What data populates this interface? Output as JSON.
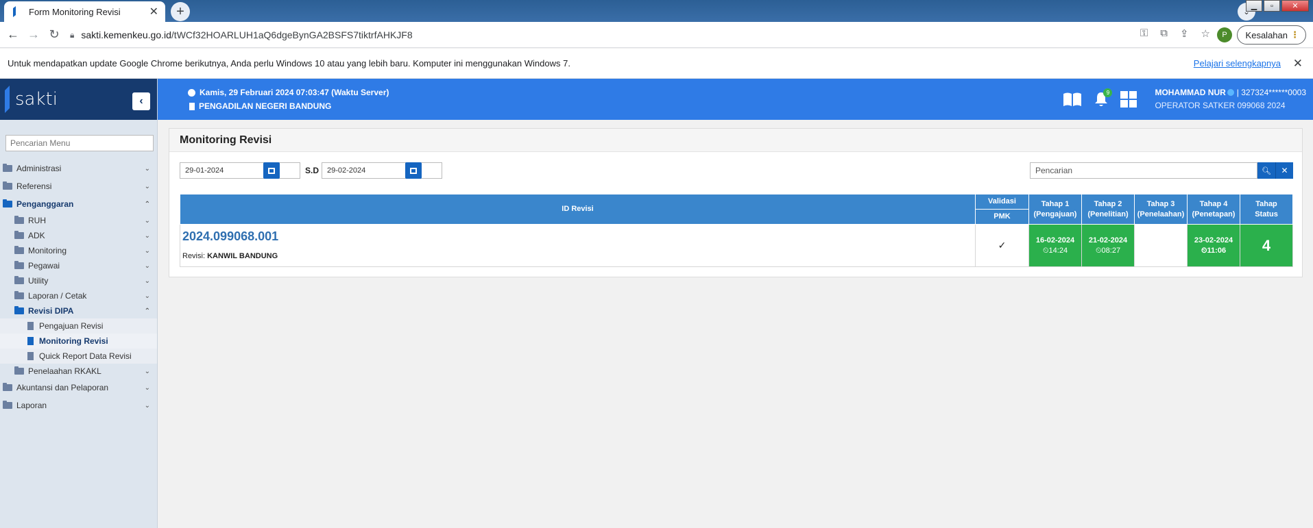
{
  "browser": {
    "tab_title": "Form Monitoring Revisi",
    "url_domain": "sakti.kemenkeu.go.id",
    "url_path": "/tWCf32HOARLUH1aQ6dgeBynGA2BSFS7tiktrfAHKJF8",
    "profile_initial": "P",
    "error_label": "Kesalahan"
  },
  "infobar": {
    "message": "Untuk mendapatkan update Google Chrome berikutnya, Anda perlu Windows 10 atau yang lebih baru. Komputer ini menggunakan Windows 7.",
    "learn_more": "Pelajari selengkapnya"
  },
  "brand": {
    "name": "sakti"
  },
  "header": {
    "datetime": "Kamis, 29 Februari 2024 07:03:47 (Waktu Server)",
    "office": "PENGADILAN NEGERI BANDUNG",
    "notification_count": "9",
    "user_name": "MOHAMMAD NUR",
    "user_id": "| 327324******0003",
    "user_role": "OPERATOR SATKER 099068 2024"
  },
  "sidebar": {
    "search_placeholder": "Pencarian Menu",
    "items": [
      {
        "label": "Administrasi"
      },
      {
        "label": "Referensi"
      },
      {
        "label": "Penganggaran"
      },
      {
        "label": "RUH"
      },
      {
        "label": "ADK"
      },
      {
        "label": "Monitoring"
      },
      {
        "label": "Pegawai"
      },
      {
        "label": "Utility"
      },
      {
        "label": "Laporan / Cetak"
      },
      {
        "label": "Revisi DIPA"
      },
      {
        "label": "Pengajuan Revisi"
      },
      {
        "label": "Monitoring Revisi"
      },
      {
        "label": "Quick Report Data Revisi"
      },
      {
        "label": "Penelaahan RKAKL"
      },
      {
        "label": "Akuntansi dan Pelaporan"
      },
      {
        "label": "Laporan"
      }
    ]
  },
  "page": {
    "title": "Monitoring Revisi",
    "date_from": "29-01-2024",
    "date_sep": "S.D",
    "date_to": "29-02-2024",
    "search_placeholder": "Pencarian"
  },
  "table": {
    "headers": {
      "id": "ID Revisi",
      "validasi": "Validasi",
      "pmk": "PMK",
      "tahap1_a": "Tahap 1",
      "tahap1_b": "(Pengajuan)",
      "tahap2_a": "Tahap 2",
      "tahap2_b": "(Penelitian)",
      "tahap3_a": "Tahap 3",
      "tahap3_b": "(Penelaahan)",
      "tahap4_a": "Tahap 4",
      "tahap4_b": "(Penetapan)",
      "status_a": "Tahap",
      "status_b": "Status"
    },
    "rows": [
      {
        "id": "2024.099068.001",
        "note_label": "Revisi:",
        "note_value": "KANWIL BANDUNG",
        "pmk": "✓",
        "t1_date": "16-02-2024",
        "t1_time": "14:24",
        "t2_date": "21-02-2024",
        "t2_time": "08:27",
        "t3_date": "",
        "t3_time": "",
        "t4_date": "23-02-2024",
        "t4_time": "11:06",
        "status": "4"
      }
    ]
  },
  "colors": {
    "header_blue": "#2f7be6",
    "brand_navy": "#163a6e",
    "table_header": "#3a86cc",
    "stage_green": "#2bb04c"
  }
}
